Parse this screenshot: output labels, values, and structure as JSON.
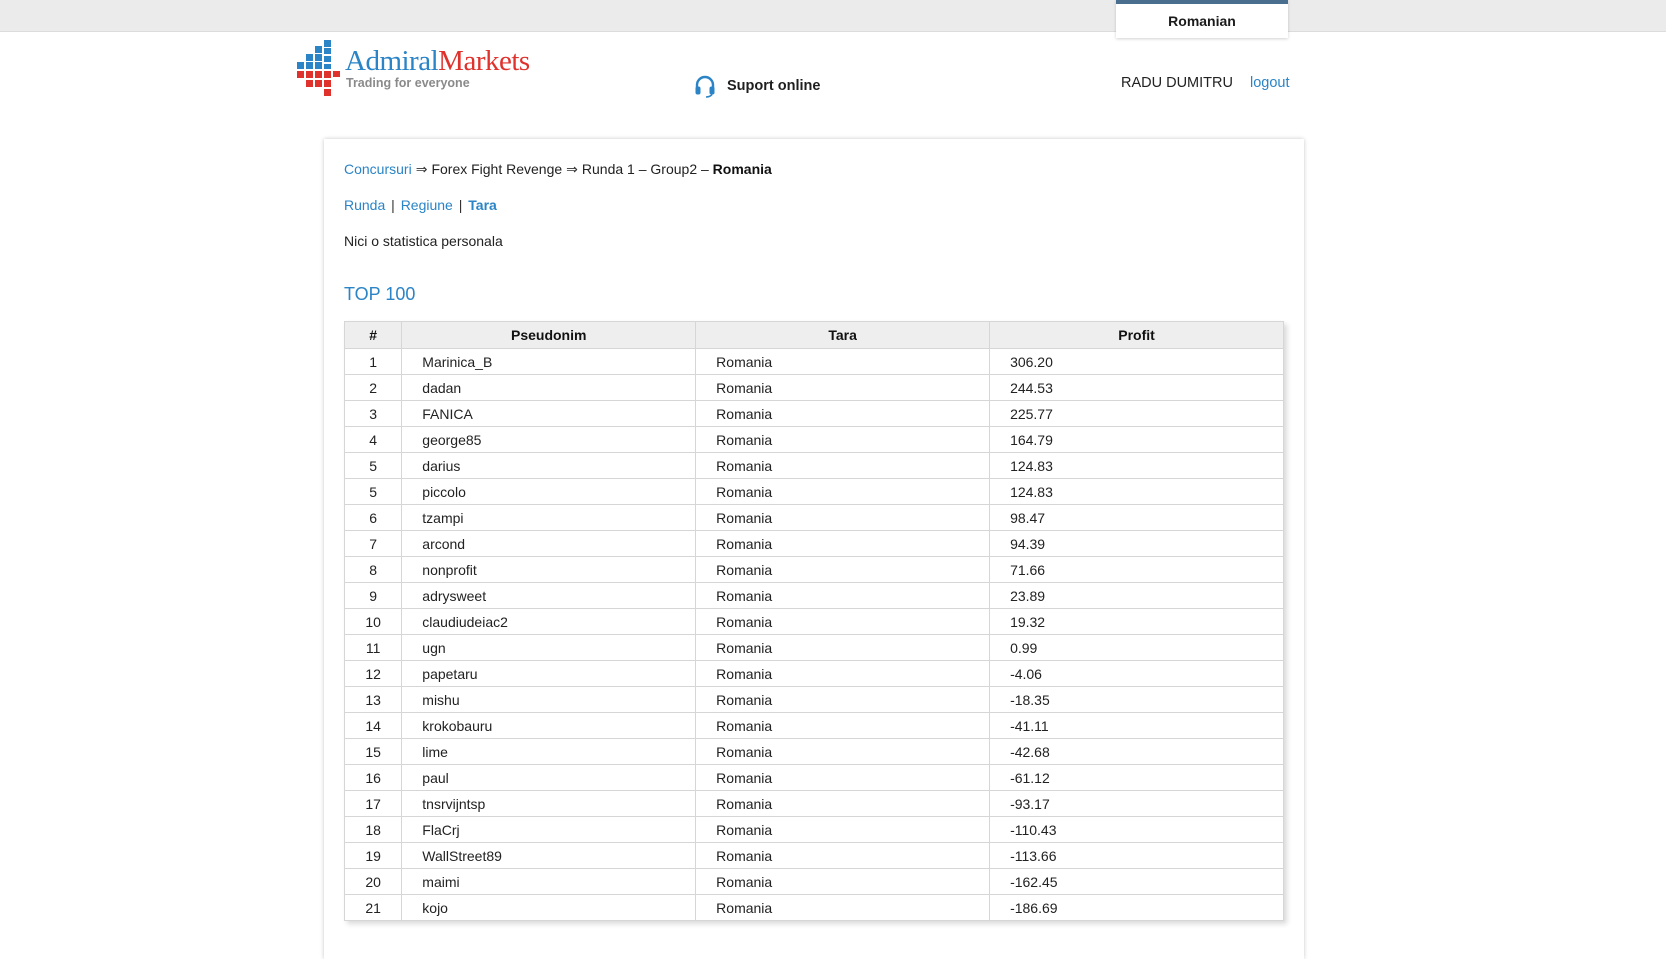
{
  "header": {
    "language": "Romanian",
    "logo": {
      "brand_part1": "Admiral",
      "brand_part2": "Markets",
      "tagline": "Trading for everyone"
    },
    "support_label": "Suport online",
    "user_name": "RADU DUMITRU",
    "logout_label": "logout"
  },
  "breadcrumb": {
    "link": "Concursuri",
    "item2": "Forex Fight Revenge",
    "item3": "Runda 1 – Group2 –",
    "current": "Romania"
  },
  "tabs": {
    "runda": "Runda",
    "regiune": "Regiune",
    "tara": "Tara",
    "active": "tara"
  },
  "stat_note": "Nici o statistica personala",
  "top_title": "TOP 100",
  "table": {
    "headers": [
      "#",
      "Pseudonim",
      "Tara",
      "Profit"
    ],
    "rows": [
      [
        "1",
        "Marinica_B",
        "Romania",
        "306.20"
      ],
      [
        "2",
        "dadan",
        "Romania",
        "244.53"
      ],
      [
        "3",
        "FANICA",
        "Romania",
        "225.77"
      ],
      [
        "4",
        "george85",
        "Romania",
        "164.79"
      ],
      [
        "5",
        "darius",
        "Romania",
        "124.83"
      ],
      [
        "5",
        "piccolo",
        "Romania",
        "124.83"
      ],
      [
        "6",
        "tzampi",
        "Romania",
        "98.47"
      ],
      [
        "7",
        "arcond",
        "Romania",
        "94.39"
      ],
      [
        "8",
        "nonprofit",
        "Romania",
        "71.66"
      ],
      [
        "9",
        "adrysweet",
        "Romania",
        "23.89"
      ],
      [
        "10",
        "claudiudeiac2",
        "Romania",
        "19.32"
      ],
      [
        "11",
        "ugn",
        "Romania",
        "0.99"
      ],
      [
        "12",
        "papetaru",
        "Romania",
        "-4.06"
      ],
      [
        "13",
        "mishu",
        "Romania",
        "-18.35"
      ],
      [
        "14",
        "krokobauru",
        "Romania",
        "-41.11"
      ],
      [
        "15",
        "lime",
        "Romania",
        "-42.68"
      ],
      [
        "16",
        "paul",
        "Romania",
        "-61.12"
      ],
      [
        "17",
        "tnsrvijntsp",
        "Romania",
        "-93.17"
      ],
      [
        "18",
        "FlaCrj",
        "Romania",
        "-110.43"
      ],
      [
        "19",
        "WallStreet89",
        "Romania",
        "-113.66"
      ],
      [
        "20",
        "maimi",
        "Romania",
        "-162.45"
      ],
      [
        "21",
        "kojo",
        "Romania",
        "-186.69"
      ]
    ]
  },
  "colors": {
    "link_blue": "#2a84c6",
    "logo_red": "#e0322d",
    "header_bg": "#eeeeee"
  }
}
